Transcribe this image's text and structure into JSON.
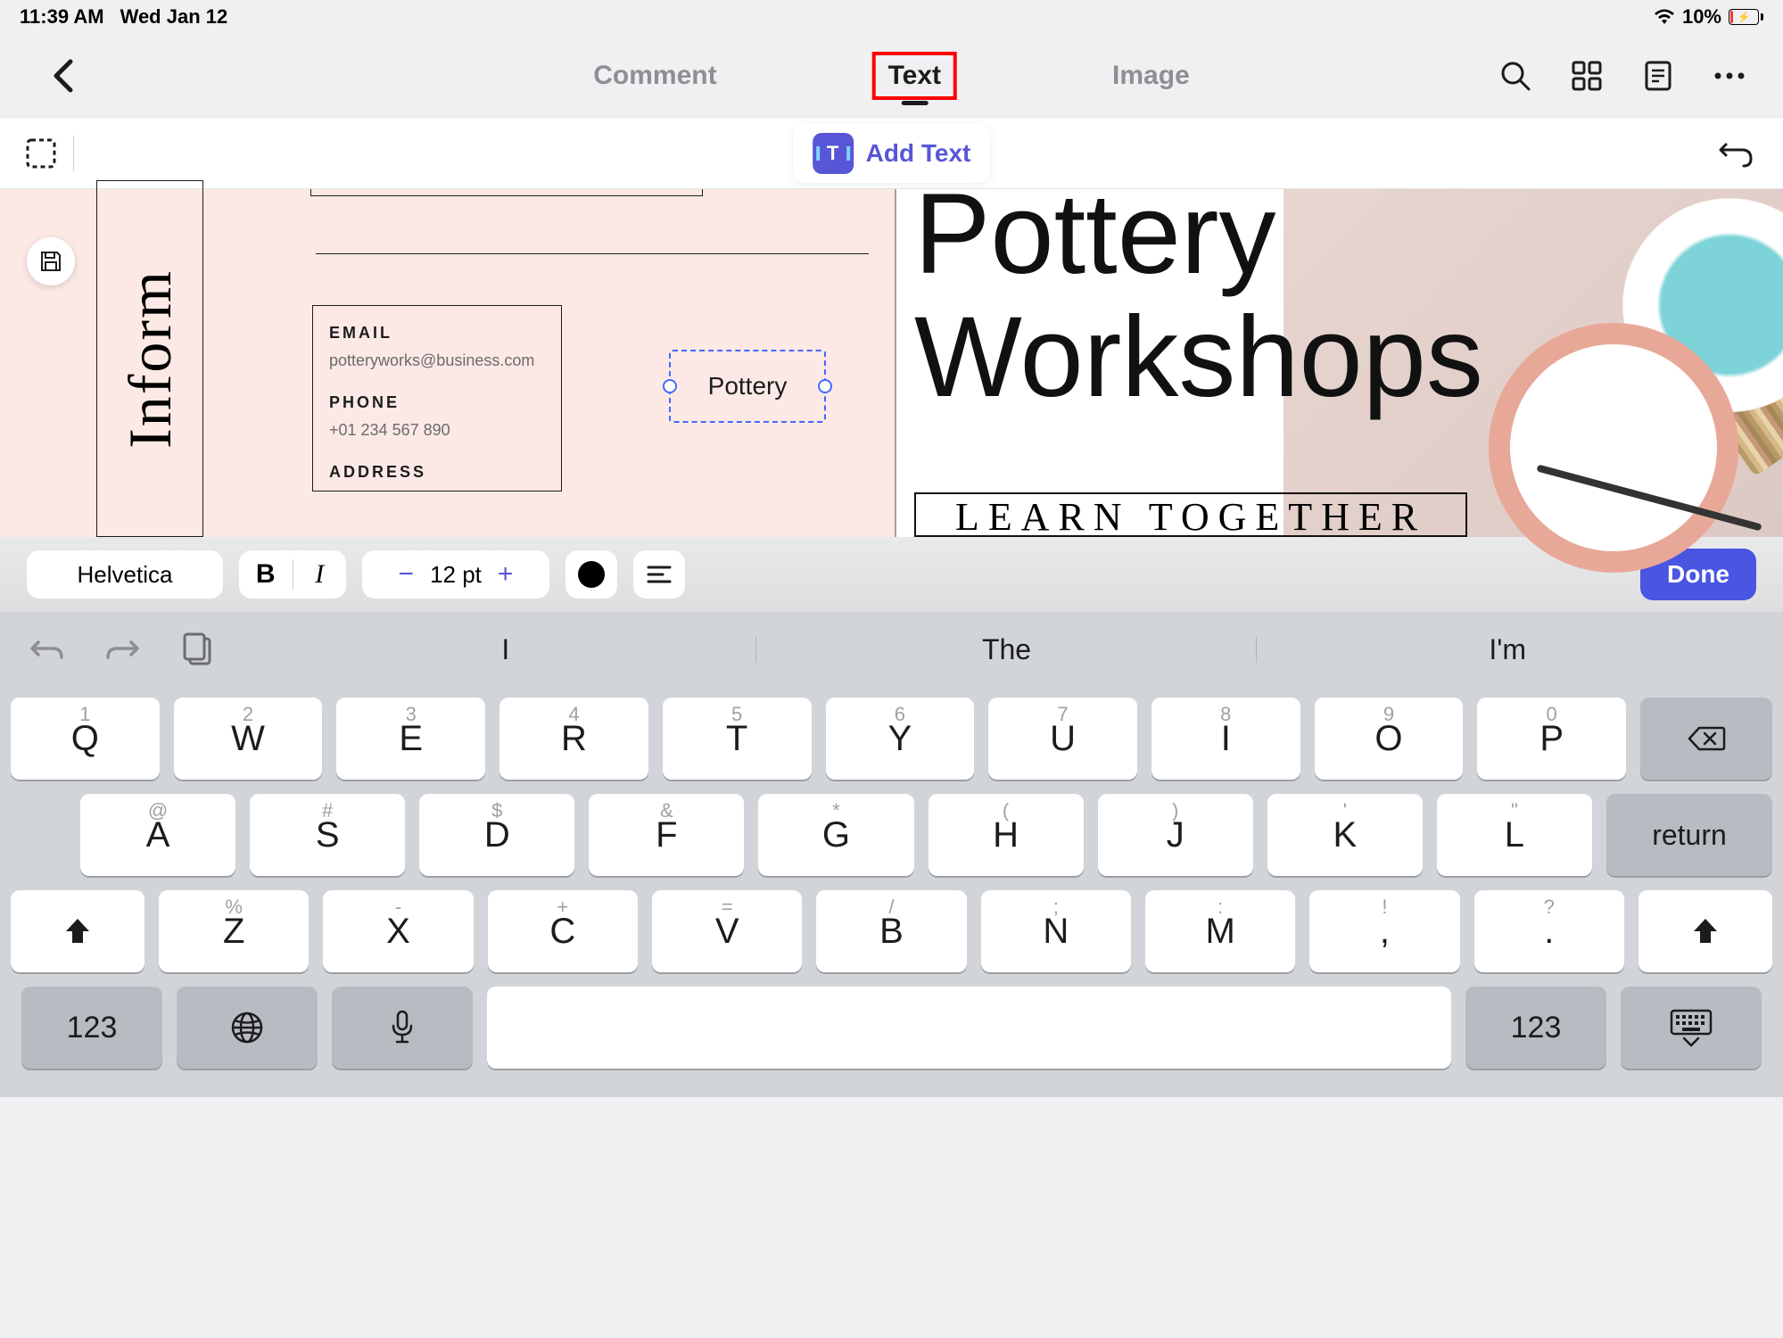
{
  "status": {
    "time": "11:39 AM",
    "date": "Wed Jan 12",
    "battery_pct": "10%"
  },
  "nav": {
    "tabs": {
      "comment": "Comment",
      "text": "Text",
      "image": "Image"
    }
  },
  "toolbar": {
    "add_text": "Add Text"
  },
  "doc": {
    "vertical_heading": "Inform",
    "email_label": "EMAIL",
    "email_value": "potteryworks@business.com",
    "phone_label": "PHONE",
    "phone_value": "+01 234 567 890",
    "address_label": "ADDRESS",
    "textbox_value": "Pottery",
    "title_line1": "Pottery",
    "title_line2": "Workshops",
    "subtitle": "LEARN TOGETHER"
  },
  "format": {
    "font": "Helvetica",
    "bold": "B",
    "italic": "I",
    "size": "12 pt",
    "done": "Done"
  },
  "kb": {
    "suggestions": [
      "I",
      "The",
      "I'm"
    ],
    "row1": [
      {
        "k": "Q",
        "s": "1"
      },
      {
        "k": "W",
        "s": "2"
      },
      {
        "k": "E",
        "s": "3"
      },
      {
        "k": "R",
        "s": "4"
      },
      {
        "k": "T",
        "s": "5"
      },
      {
        "k": "Y",
        "s": "6"
      },
      {
        "k": "U",
        "s": "7"
      },
      {
        "k": "I",
        "s": "8"
      },
      {
        "k": "O",
        "s": "9"
      },
      {
        "k": "P",
        "s": "0"
      }
    ],
    "row2": [
      {
        "k": "A",
        "s": "@"
      },
      {
        "k": "S",
        "s": "#"
      },
      {
        "k": "D",
        "s": "$"
      },
      {
        "k": "F",
        "s": "&"
      },
      {
        "k": "G",
        "s": "*"
      },
      {
        "k": "H",
        "s": "("
      },
      {
        "k": "J",
        "s": ")"
      },
      {
        "k": "K",
        "s": "'"
      },
      {
        "k": "L",
        "s": "\""
      }
    ],
    "row3": [
      {
        "k": "Z",
        "s": "%"
      },
      {
        "k": "X",
        "s": "-"
      },
      {
        "k": "C",
        "s": "+"
      },
      {
        "k": "V",
        "s": "="
      },
      {
        "k": "B",
        "s": "/"
      },
      {
        "k": "N",
        "s": ";"
      },
      {
        "k": "M",
        "s": ":"
      },
      {
        "k": ",",
        "s": "!"
      },
      {
        "k": ".",
        "s": "?"
      }
    ],
    "return": "return",
    "numkey": "123"
  }
}
